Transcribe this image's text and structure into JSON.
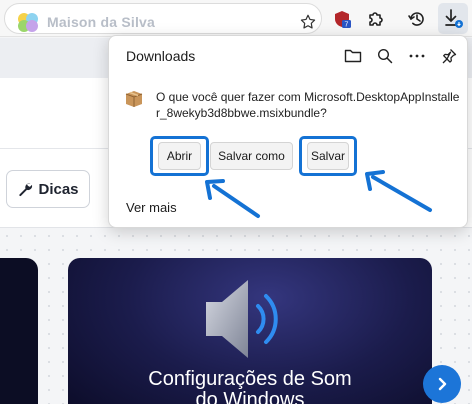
{
  "site": {
    "name": "Maison da Silva"
  },
  "toolbar": {
    "icons": [
      "favorite-star-icon",
      "extension-shield-icon",
      "extensions-puzzle-icon",
      "history-icon",
      "downloads-icon"
    ],
    "extension_badge": "7"
  },
  "page": {
    "dicas_label": "Dicas",
    "card_title_line1": "Configurações de Som",
    "card_title_line2": "do Windows"
  },
  "downloads": {
    "title": "Downloads",
    "header_icons": [
      "folder-icon",
      "search-icon",
      "more-icon",
      "pin-icon"
    ],
    "message": "O que você quer fazer com Microsoft.DesktopAppInstaller_8wekyb3d8bbwe.msixbundle?",
    "buttons": {
      "open": "Abrir",
      "save_as": "Salvar como",
      "save": "Salvar"
    },
    "see_more": "Ver mais"
  },
  "colors": {
    "accent": "#1472d4",
    "card_bg": "#1b1c4c"
  }
}
